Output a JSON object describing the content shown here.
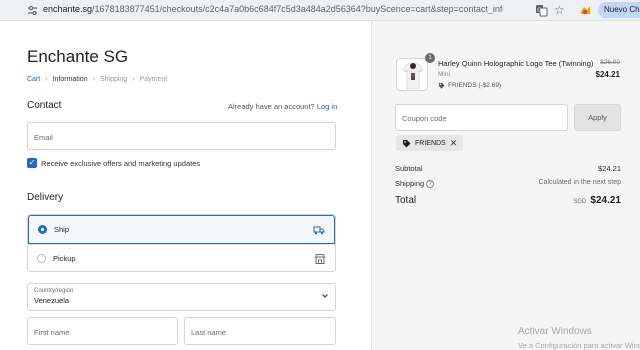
{
  "browser": {
    "url_host": "enchante.sg",
    "url_path": "/1678183877451/checkouts/c2c4a7a0b6c684f7c5d3a484a2d56364?buyScence=cart&step=contact_information",
    "profile_label": "Nuevo Chrome"
  },
  "store": {
    "title": "Enchante SG"
  },
  "breadcrumb": {
    "cart": "Cart",
    "information": "Information",
    "shipping": "Shipping",
    "payment": "Payment"
  },
  "contact": {
    "heading": "Contact",
    "account_prompt": "Already have an account?",
    "login_label": "Log in",
    "email_placeholder": "Email",
    "offers_label": "Receive exclusive offers and marketing updates"
  },
  "delivery": {
    "heading": "Delivery",
    "options": [
      {
        "label": "Ship",
        "icon": "truck-icon"
      },
      {
        "label": "Pickup",
        "icon": "store-icon"
      }
    ],
    "country_label": "Country/region",
    "country_value": "Venezuela",
    "first_name_placeholder": "First name",
    "last_name_placeholder": "Last name"
  },
  "order": {
    "quantity": "1",
    "product_name": "Harley Quinn Holographic Logo Tee (Twinning)",
    "variant": "Mini",
    "discount_line": "FRIENDS (-$2.69)",
    "price_old": "$26.90",
    "price_new": "$24.21",
    "coupon_placeholder": "Coupon code",
    "apply_label": "Apply",
    "applied_code": "FRIENDS",
    "subtotal_label": "Subtotal",
    "subtotal_value": "$24.21",
    "shipping_label": "Shipping",
    "shipping_value": "Calculated in the next step",
    "total_label": "Total",
    "currency": "SGD",
    "total_value": "$24.21"
  },
  "watermark": {
    "title": "Activar Windows",
    "subtitle": "Ve a Configuración para activar Windows."
  },
  "colors": {
    "accent": "#2568c9",
    "sidebar_bg": "#f5f5f5"
  }
}
